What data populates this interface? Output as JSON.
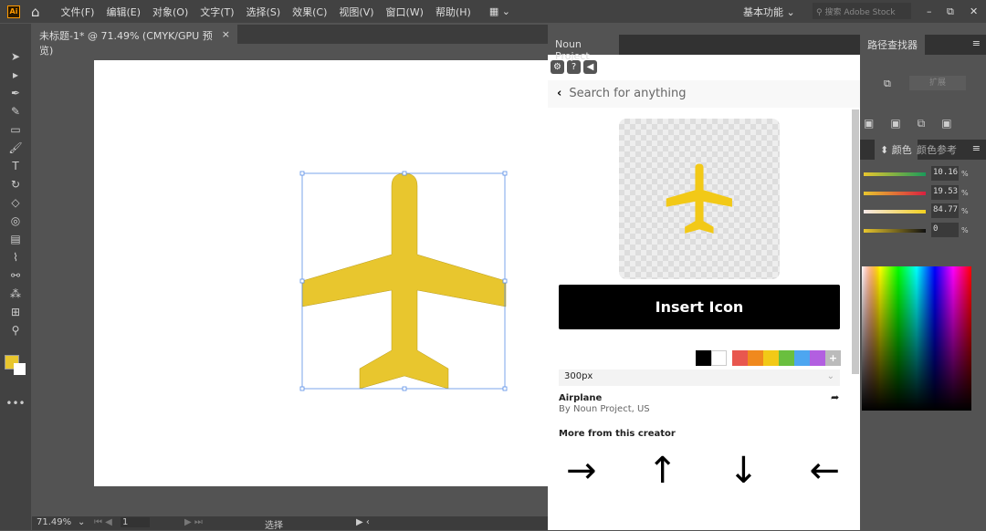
{
  "menubar": {
    "app_logo": "Ai",
    "items": [
      "文件(F)",
      "编辑(E)",
      "对象(O)",
      "文字(T)",
      "选择(S)",
      "效果(C)",
      "视图(V)",
      "窗口(W)",
      "帮助(H)"
    ],
    "workspace": "基本功能",
    "stock_search_placeholder": "搜索 Adobe Stock"
  },
  "document": {
    "tab_title": "未标题-1* @ 71.49% (CMYK/GPU 预览)",
    "close": "×"
  },
  "statusbar": {
    "zoom": "71.49%",
    "page": "1",
    "tool": "选择"
  },
  "noun_panel": {
    "tab": "Noun Project",
    "search_placeholder": "Search for anything",
    "insert_button": "Insert Icon",
    "size": "300px",
    "icon_name": "Airplane",
    "icon_author": "By Noun Project, US",
    "more_heading": "More from this creator",
    "icon_color": "#f2c917",
    "swatches": [
      "#000000",
      "#ffffff",
      "#e8574f",
      "#f0891e",
      "#f2c917",
      "#6abf3f",
      "#4da6f0",
      "#b25fe0"
    ],
    "related_icons": [
      "→",
      "↑",
      "↓",
      "←"
    ]
  },
  "right_panel": {
    "pathfinder_tab": "路径查找器",
    "expand_button": "扩展",
    "color_tab": "颜色",
    "color_guide_tab": "颜色参考",
    "cmyk": [
      "10.16",
      "19.53",
      "84.77",
      "0"
    ],
    "percent": "%"
  },
  "artwork": {
    "fill": "#e8c62e"
  }
}
